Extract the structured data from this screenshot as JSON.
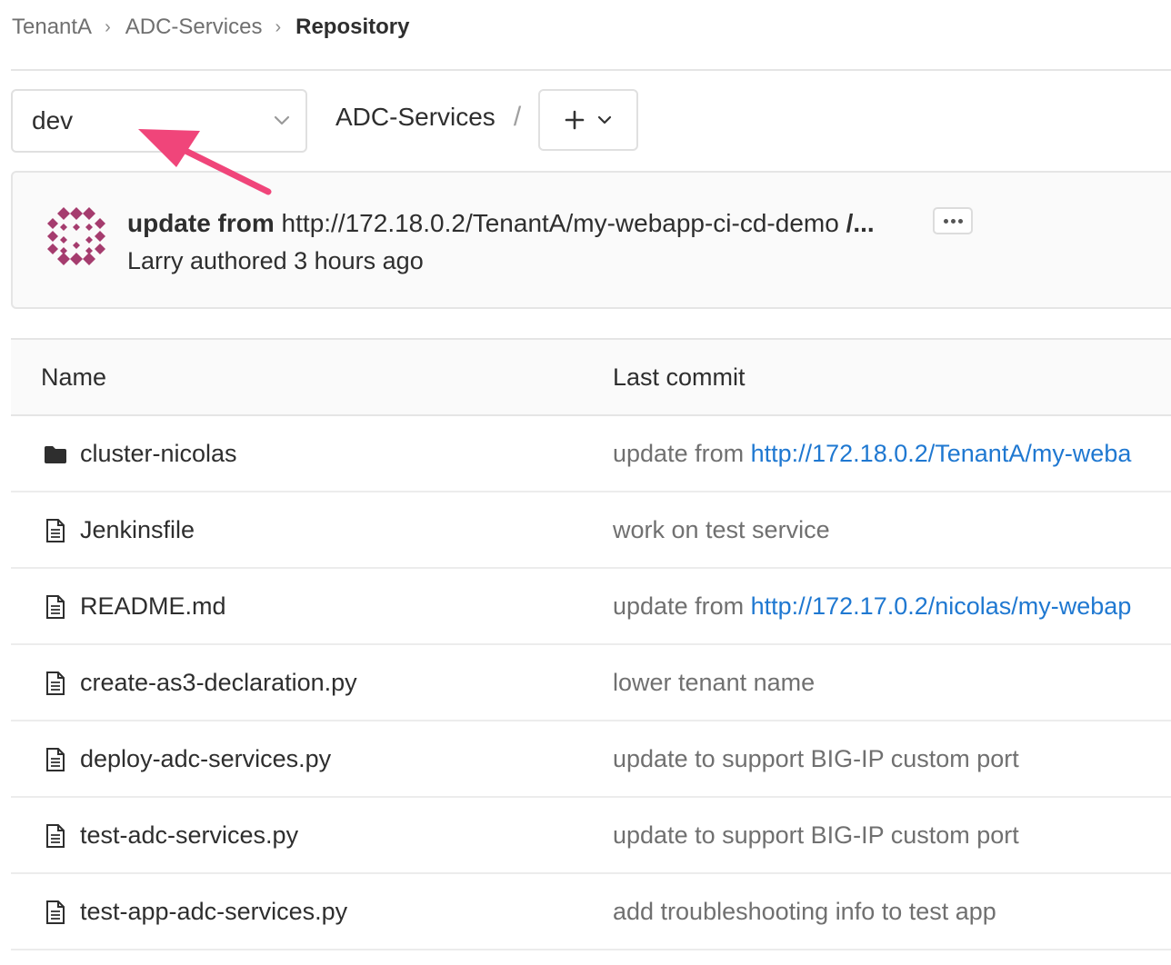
{
  "breadcrumb": {
    "items": [
      "TenantA",
      "ADC-Services",
      "Repository"
    ],
    "separator": "›"
  },
  "branch_selector": {
    "value": "dev"
  },
  "project_path": {
    "name": "ADC-Services",
    "slash": "/"
  },
  "add_button": {
    "icon": "plus-icon",
    "dropdown_icon": "chevron-down-icon"
  },
  "last_commit": {
    "title_bold": "update from",
    "title_rest": " http://172.18.0.2/TenantA/my-webapp-ci-cd-demo ",
    "title_trunc": "/...",
    "author_line": "Larry authored 3 hours ago"
  },
  "table": {
    "headers": {
      "name": "Name",
      "last_commit": "Last commit"
    },
    "rows": [
      {
        "type": "folder",
        "name": "cluster-nicolas",
        "commit_prefix": "update from ",
        "commit_link": "http://172.18.0.2/TenantA/my-weba"
      },
      {
        "type": "file",
        "name": "Jenkinsfile",
        "commit_prefix": "work on test service",
        "commit_link": ""
      },
      {
        "type": "file",
        "name": "README.md",
        "commit_prefix": "update from ",
        "commit_link": "http://172.17.0.2/nicolas/my-webap"
      },
      {
        "type": "file",
        "name": "create-as3-declaration.py",
        "commit_prefix": "lower tenant name",
        "commit_link": ""
      },
      {
        "type": "file",
        "name": "deploy-adc-services.py",
        "commit_prefix": "update to support BIG-IP custom port",
        "commit_link": ""
      },
      {
        "type": "file",
        "name": "test-adc-services.py",
        "commit_prefix": "update to support BIG-IP custom port",
        "commit_link": ""
      },
      {
        "type": "file",
        "name": "test-app-adc-services.py",
        "commit_prefix": "add troubleshooting info to test app",
        "commit_link": ""
      }
    ]
  },
  "colors": {
    "link": "#1f78d1",
    "annotation_arrow": "#f0457a",
    "avatar": "#a53c6e"
  }
}
